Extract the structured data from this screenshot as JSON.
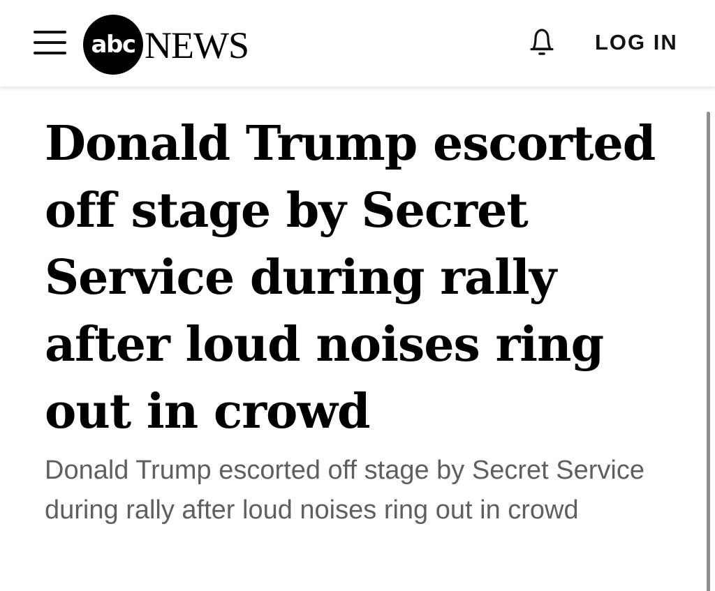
{
  "header": {
    "menu_icon": "hamburger-menu-icon",
    "logo": {
      "circle_text": "abc",
      "brand_text": "NEWS"
    },
    "notification_icon": "bell-icon",
    "login_label": "LOG IN"
  },
  "article": {
    "headline": "Donald Trump escorted off stage by Secret Service during rally after loud noises ring out in crowd",
    "subheadline": "Donald Trump escorted off stage by Secret Service during rally after loud noises ring out in crowd"
  },
  "colors": {
    "brand": "#000000",
    "background": "#ffffff",
    "subheadline_text": "#5f5f5f",
    "scrollbar": "#8e8e8e"
  }
}
